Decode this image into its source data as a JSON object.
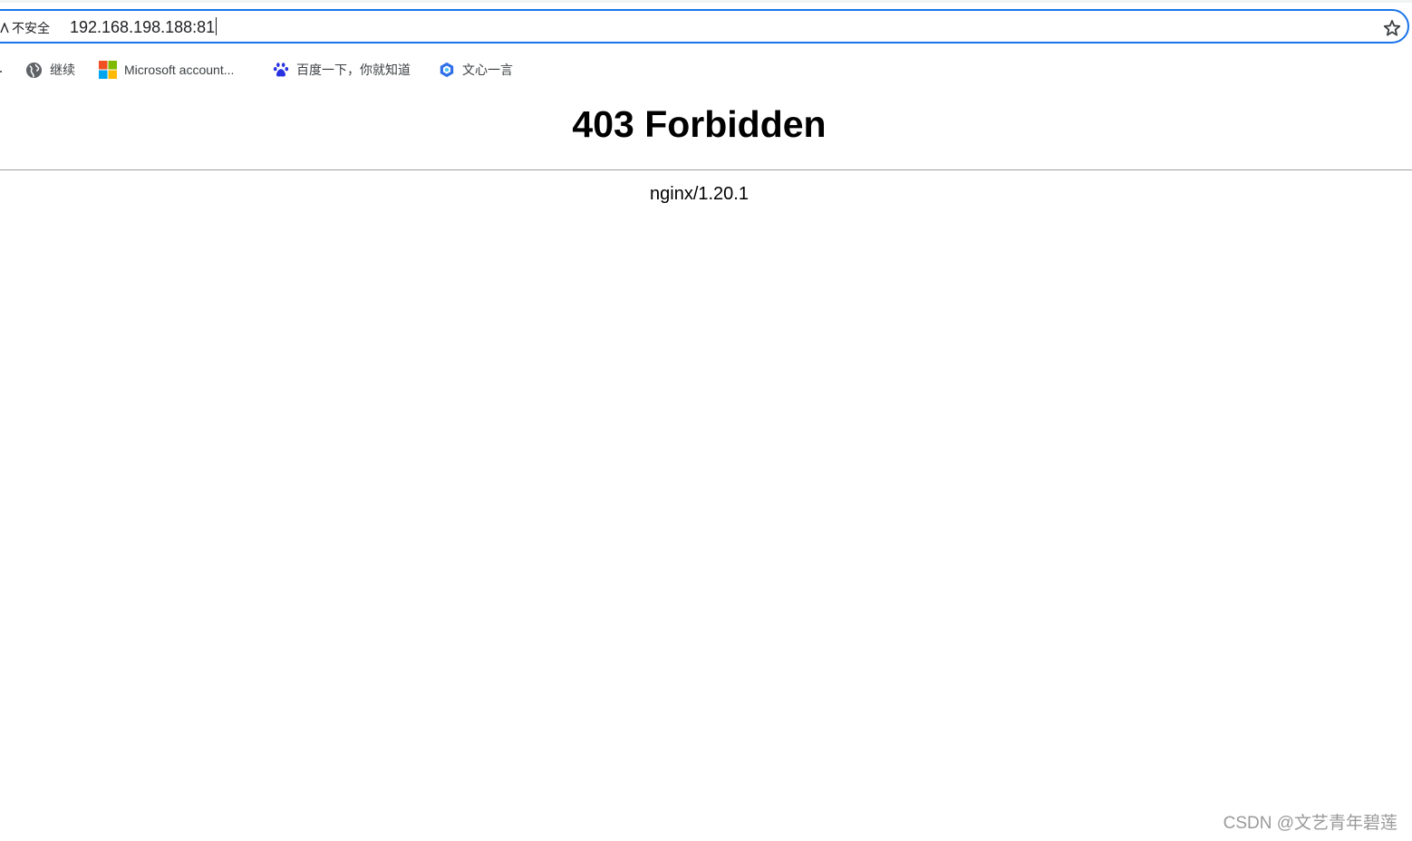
{
  "address_bar": {
    "security_label": "不安全",
    "url": "192.168.198.188:81"
  },
  "bookmarks": [
    {
      "label": "继续",
      "icon": "globe-icon"
    },
    {
      "label": "Microsoft account...",
      "icon": "microsoft-logo-icon"
    },
    {
      "label": "百度一下，你就知道",
      "icon": "baidu-paw-icon"
    },
    {
      "label": "文心一言",
      "icon": "wenxin-cube-icon"
    }
  ],
  "page": {
    "heading": "403 Forbidden",
    "server_signature": "nginx/1.20.1"
  },
  "watermark": "CSDN @文艺青年碧莲",
  "colors": {
    "omnibox_focus": "#1a73e8",
    "microsoft_red": "#f25022",
    "microsoft_green": "#7fba00",
    "microsoft_blue": "#00a4ef",
    "microsoft_yellow": "#ffb900",
    "baidu_blue": "#2932e1"
  }
}
